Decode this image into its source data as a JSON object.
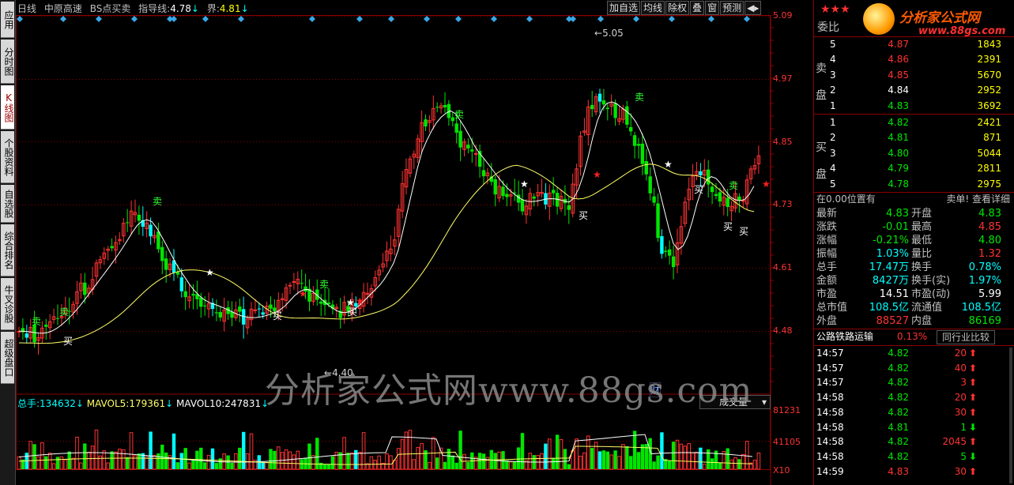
{
  "sidetabs": [
    "应用",
    "分时图",
    "K线图",
    "个股资料",
    "自选股",
    "综合排名",
    "牛叉诊股",
    "超级盘口"
  ],
  "top": {
    "period": "日线",
    "stock": "中原高速",
    "indicator": "BS点买卖",
    "guide_label": "指导线:",
    "guide_value": "4.78",
    "bound_label": "界:",
    "bound_value": "4.81"
  },
  "toolbar": [
    "加自选",
    "均线",
    "除权",
    "叠",
    "窗",
    "预测",
    "◀▸"
  ],
  "price_axis": [
    "5.09",
    "4.97",
    "4.85",
    "4.73",
    "4.61",
    "4.48"
  ],
  "chart_labels": {
    "high": "5.05",
    "low": "4.40",
    "cai": "财",
    "buy": "买",
    "sell": "卖"
  },
  "volume": {
    "label": "总手:",
    "value": "134632",
    "mavol5_label": "MAVOL5:",
    "mavol5": "179361",
    "mavol10_label": "MAVOL10:",
    "mavol10": "247831",
    "select": "成交量",
    "axis": [
      "81231",
      "41105",
      "X10"
    ]
  },
  "watermark": "分析家公式网www.88gs.com",
  "logo": {
    "brand": "分析家公式网",
    "url": "www.88gs.com"
  },
  "panel": {
    "weibi": "委比",
    "sell_label": [
      "卖",
      "盘"
    ],
    "buy_label": [
      "买",
      "盘"
    ],
    "sell": [
      {
        "n": "5",
        "p": "4.87",
        "v": "1843",
        "pc": "red"
      },
      {
        "n": "4",
        "p": "4.86",
        "v": "2391",
        "pc": "red"
      },
      {
        "n": "3",
        "p": "4.85",
        "v": "5670",
        "pc": "red"
      },
      {
        "n": "2",
        "p": "4.84",
        "v": "2952",
        "pc": "white"
      },
      {
        "n": "1",
        "p": "4.83",
        "v": "3692",
        "pc": "green"
      }
    ],
    "buy": [
      {
        "n": "1",
        "p": "4.82",
        "v": "2421"
      },
      {
        "n": "2",
        "p": "4.81",
        "v": "871"
      },
      {
        "n": "3",
        "p": "4.80",
        "v": "5044"
      },
      {
        "n": "4",
        "p": "4.79",
        "v": "2811"
      },
      {
        "n": "5",
        "p": "4.78",
        "v": "2975"
      }
    ],
    "position": "在0.00位置有",
    "detail": "卖单! 查看详细",
    "stats": [
      [
        "最新",
        "4.83",
        "green",
        "开盘",
        "4.83",
        "green"
      ],
      [
        "涨跌",
        "-0.01",
        "green",
        "最高",
        "4.85",
        "red"
      ],
      [
        "涨幅",
        "-0.21%",
        "green",
        "最低",
        "4.80",
        "green"
      ],
      [
        "振幅",
        "1.03%",
        "cyan",
        "量比",
        "1.32",
        "red"
      ],
      [
        "总手",
        "17.47万",
        "cyan",
        "换手",
        "0.78%",
        "cyan"
      ],
      [
        "金额",
        "8427万",
        "cyan",
        "换手(实)",
        "1.97%",
        "cyan"
      ],
      [
        "市盈",
        "14.51",
        "white",
        "市盈(动)",
        "5.99",
        "white"
      ],
      [
        "总市值",
        "108.5亿",
        "cyan",
        "流通值",
        "108.5亿",
        "cyan"
      ],
      [
        "外盘",
        "88527",
        "red",
        "内盘",
        "86169",
        "green"
      ]
    ],
    "sector": "公路铁路运输",
    "sector_pct": "0.13%",
    "compare": "同行业比较",
    "ticks": [
      [
        "14:57",
        "4.82",
        "20",
        "up"
      ],
      [
        "14:57",
        "4.82",
        "40",
        "up"
      ],
      [
        "14:57",
        "4.82",
        "3",
        "up"
      ],
      [
        "14:58",
        "4.82",
        "20",
        "up"
      ],
      [
        "14:58",
        "4.82",
        "30",
        "up"
      ],
      [
        "14:58",
        "4.81",
        "1",
        "down"
      ],
      [
        "14:58",
        "4.82",
        "2045",
        "up"
      ],
      [
        "14:58",
        "4.82",
        "5",
        "down"
      ],
      [
        "14:59",
        "4.83",
        "30",
        "up"
      ]
    ]
  },
  "colors": {
    "up": "#ff3232",
    "down": "#00e600",
    "flat": "#00ffff",
    "grid": "#8b0000",
    "ma1": "#ffffff",
    "ma2": "#ffff66"
  }
}
